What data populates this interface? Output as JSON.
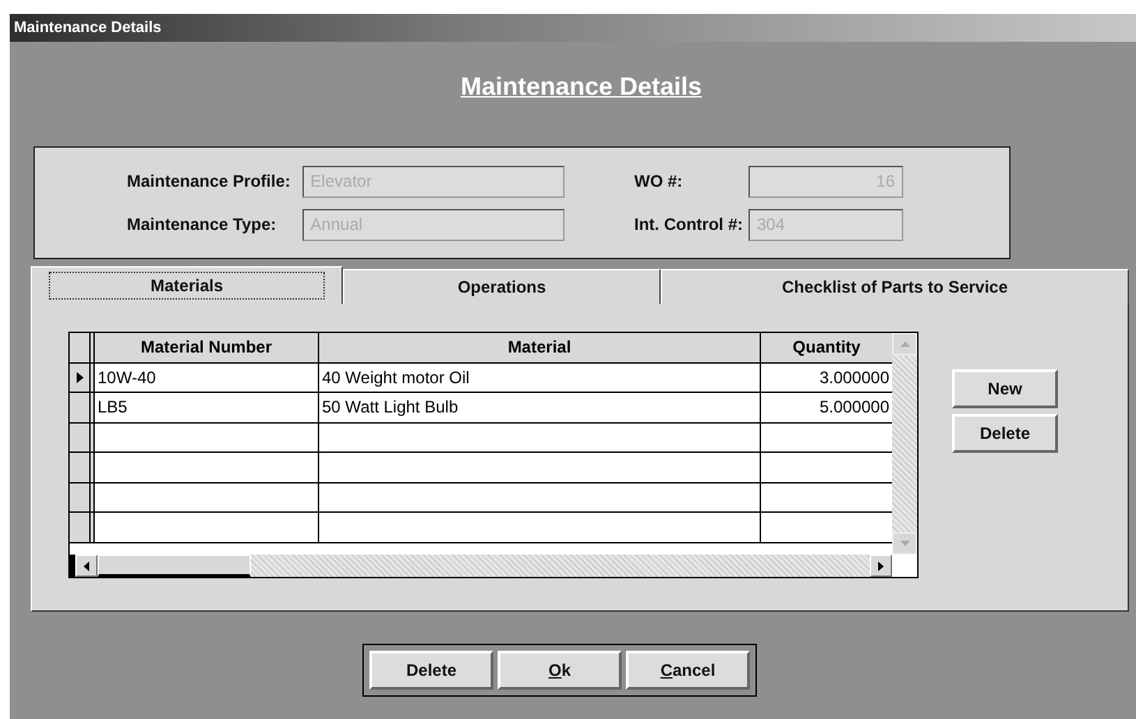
{
  "window": {
    "title": "Maintenance Details"
  },
  "heading": "Maintenance Details",
  "info": {
    "fields": [
      {
        "label": "Maintenance Profile:",
        "value": "Elevator",
        "disabled": true,
        "kind": "text"
      },
      {
        "label": "WO #:",
        "value": "16",
        "disabled": true,
        "kind": "number"
      },
      {
        "label": "Maintenance Type:",
        "value": "Annual",
        "disabled": true,
        "kind": "text"
      },
      {
        "label": "Int. Control #:",
        "value": "304",
        "disabled": true,
        "kind": "text"
      }
    ]
  },
  "tabs": [
    {
      "label": "Materials",
      "selected": true
    },
    {
      "label": "Operations",
      "selected": false
    },
    {
      "label": "Checklist of Parts to Service",
      "selected": false
    }
  ],
  "table": {
    "columns": [
      "Material Number",
      "Material",
      "Quantity"
    ],
    "rows": [
      {
        "cells": [
          "10W-40",
          "40 Weight motor Oil",
          "3.000000"
        ],
        "selected": true
      },
      {
        "cells": [
          "LB5",
          "50 Watt Light Bulb",
          "5.000000"
        ],
        "selected": false
      }
    ]
  },
  "side_buttons": [
    {
      "label": "New"
    },
    {
      "label": "Delete"
    }
  ],
  "buttons": [
    {
      "label": "Delete",
      "mnemonic": false
    },
    {
      "label": "Ok",
      "mnemonic": true
    },
    {
      "label": "Cancel",
      "mnemonic": true
    }
  ]
}
